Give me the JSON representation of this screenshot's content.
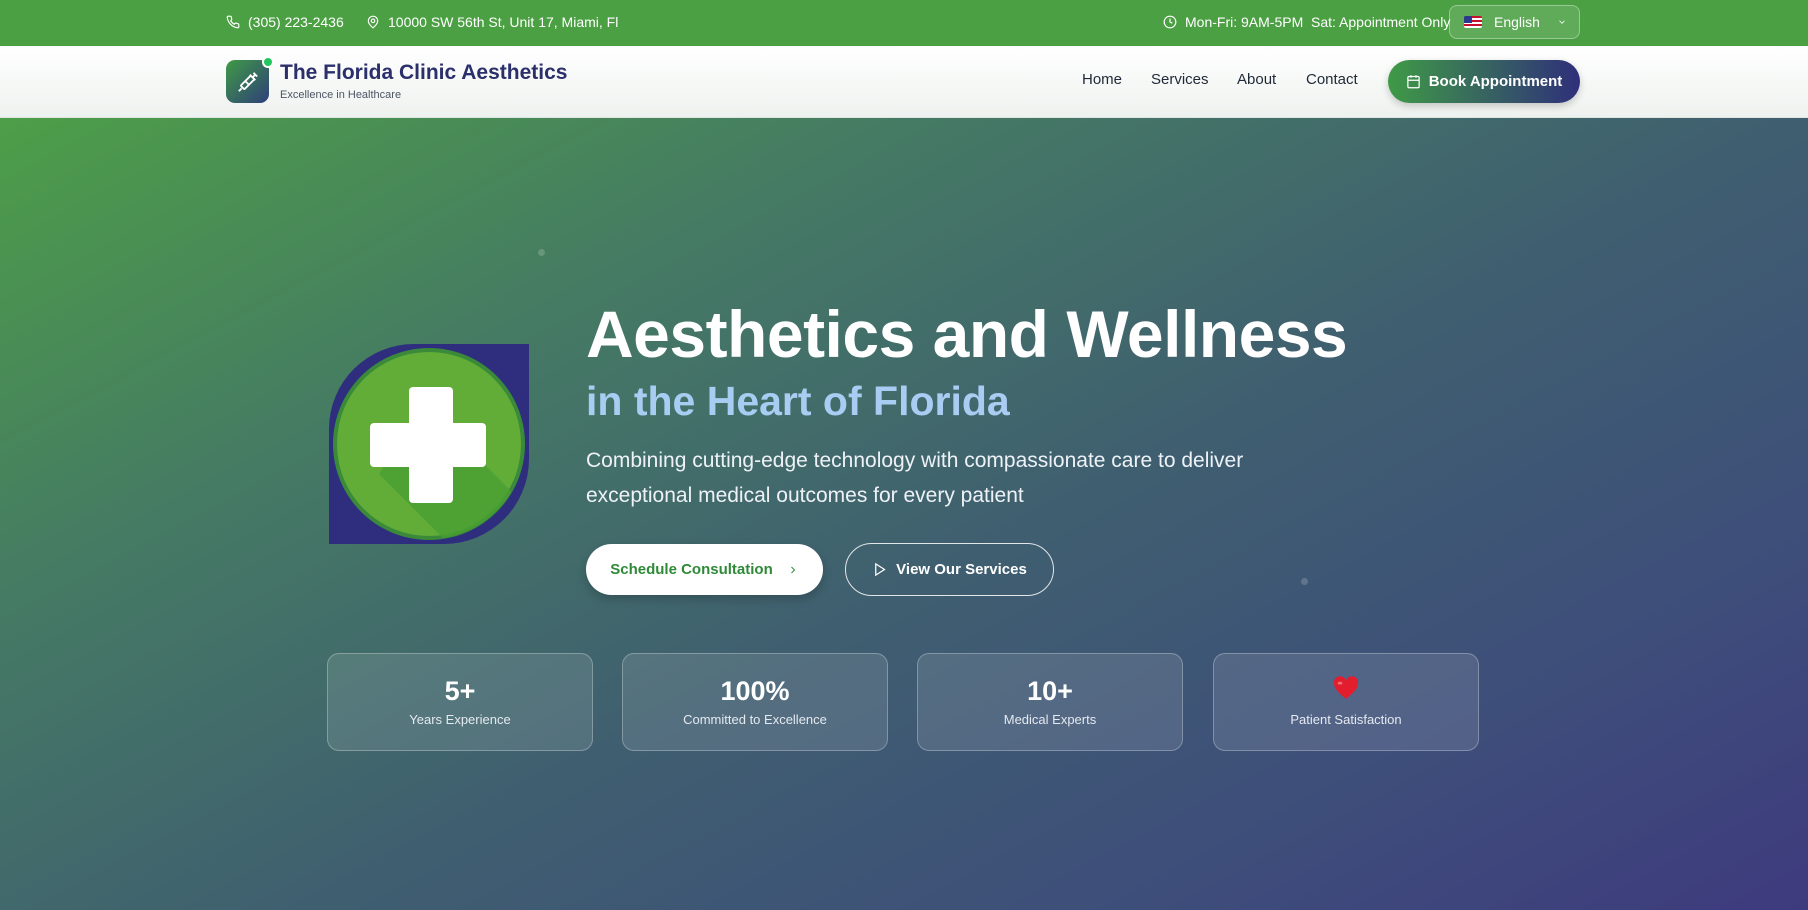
{
  "topbar": {
    "phone": "(305) 223-2436",
    "address": "10000 SW 56th St, Unit 17, Miami, Fl",
    "hours": "Mon-Fri: 9AM-5PM  Sat: Appointment Only",
    "language": "English"
  },
  "header": {
    "brand_name": "The Florida Clinic Aesthetics",
    "brand_tagline": "Excellence in Healthcare",
    "nav": [
      "Home",
      "Services",
      "About",
      "Contact"
    ],
    "book_label": "Book Appointment"
  },
  "hero": {
    "title": "Aesthetics and Wellness",
    "subtitle": "in the Heart of Florida",
    "description": "Combining cutting-edge technology with compassionate care to deliver exceptional medical outcomes for every patient",
    "primary_cta": "Schedule Consultation",
    "secondary_cta": "View Our Services",
    "stats": [
      {
        "value": "5+",
        "label": "Years Experience"
      },
      {
        "value": "100%",
        "label": "Committed to Excellence"
      },
      {
        "value": "10+",
        "label": "Medical Experts"
      },
      {
        "value": "",
        "icon": "heart-icon",
        "label": "Patient Satisfaction"
      }
    ]
  },
  "colors": {
    "topbar_bg": "#4ba043",
    "brand_navy": "#2b2f6b",
    "accent_green": "#3f9a46",
    "subtitle_blue": "#a9cdf2"
  }
}
